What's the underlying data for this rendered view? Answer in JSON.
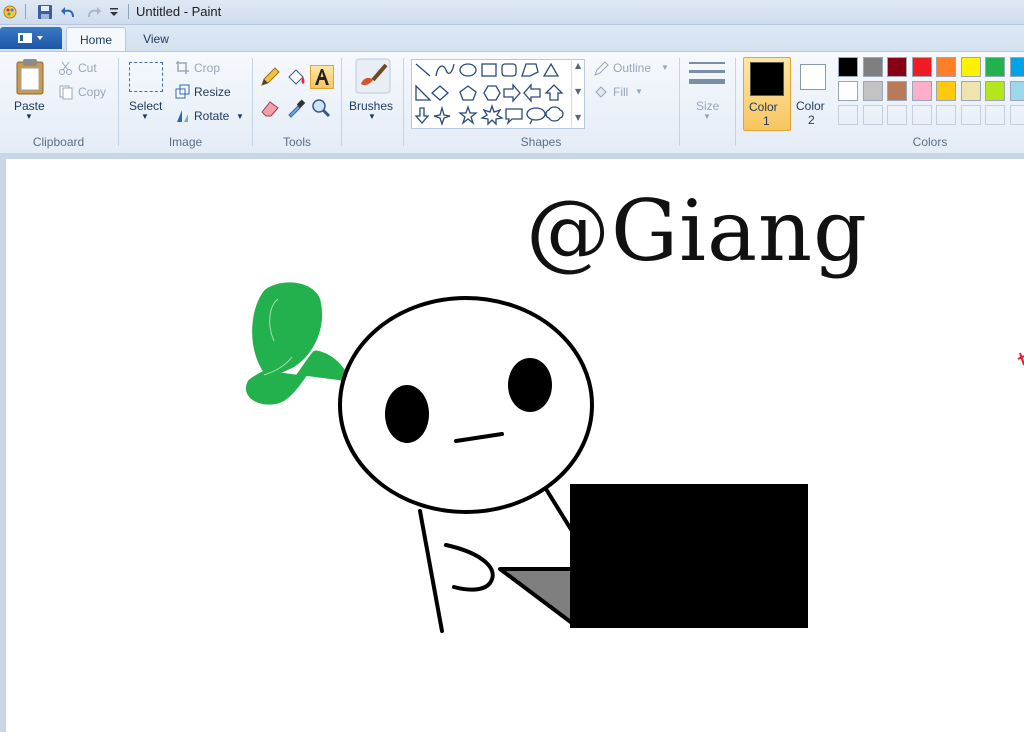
{
  "window": {
    "title": "Untitled - Paint"
  },
  "tabs": {
    "home": "Home",
    "view": "View"
  },
  "ribbon": {
    "clipboard": {
      "label": "Clipboard",
      "paste": "Paste",
      "cut": "Cut",
      "copy": "Copy"
    },
    "image": {
      "label": "Image",
      "select": "Select",
      "crop": "Crop",
      "resize": "Resize",
      "rotate": "Rotate"
    },
    "tools": {
      "label": "Tools"
    },
    "brushes": {
      "label": "Brushes"
    },
    "shapes": {
      "label": "Shapes",
      "outline": "Outline",
      "fill": "Fill"
    },
    "size": {
      "label": "Size"
    },
    "colors": {
      "label": "Colors",
      "color1": "Color",
      "color1_num": "1",
      "color2": "Color",
      "color2_num": "2",
      "color1_value": "#000000",
      "color2_value": "#ffffff",
      "palette_row1": [
        "#000000",
        "#7f7f7f",
        "#880015",
        "#ed1c24",
        "#ff7f27",
        "#fff200",
        "#22b14c",
        "#00a2e8"
      ],
      "palette_row2": [
        "#ffffff",
        "#c3c3c3",
        "#b97a57",
        "#ffaec9",
        "#ffc90e",
        "#efe4b0",
        "#b5e61d",
        "#99d9ea"
      ]
    }
  },
  "canvas": {
    "text": "@Giang"
  }
}
